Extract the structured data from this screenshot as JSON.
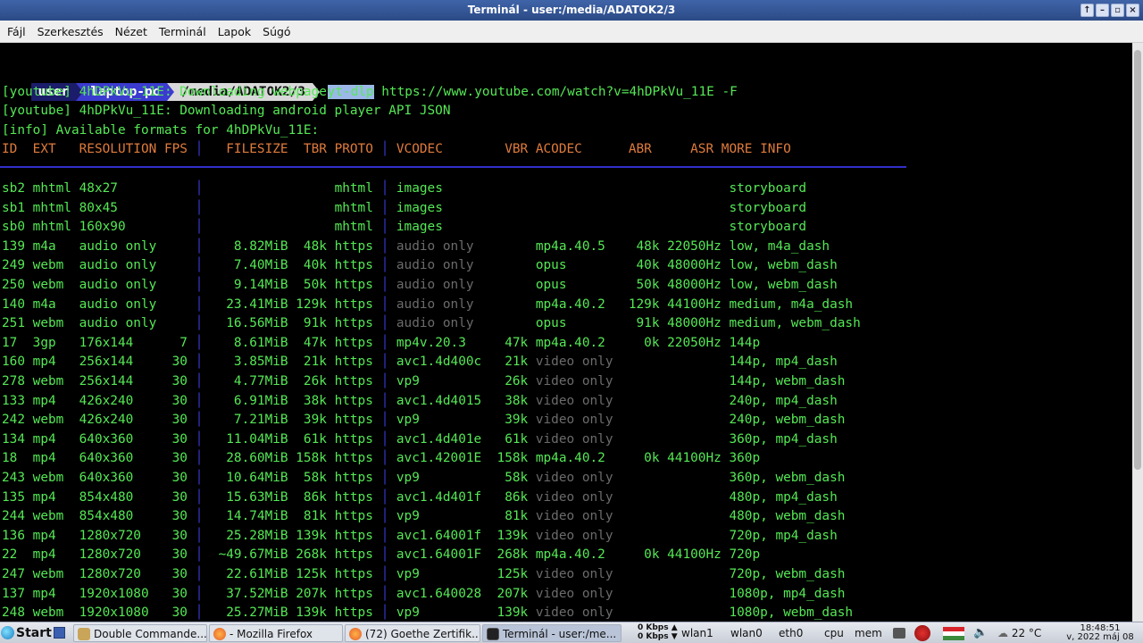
{
  "window": {
    "title": "Terminál - user:/media/ADATOK2/3",
    "buttons": [
      "↑",
      "–",
      "▫",
      "×"
    ]
  },
  "menu": [
    "Fájl",
    "Szerkesztés",
    "Nézet",
    "Terminál",
    "Lapok",
    "Súgó"
  ],
  "prompt": {
    "user": "user",
    "host": "laptop-pc",
    "path": "/media/ADATOK2/3",
    "command_selected": "yt-dlp",
    "command_rest": " https://www.youtube.com/watch?v=4hDPkVu_11E -F"
  },
  "log_lines": [
    "[youtube] 4hDPkVu_11E: Downloading webpage",
    "[youtube] 4hDPkVu_11E: Downloading android player API JSON",
    "[info] Available formats for 4hDPkVu_11E:"
  ],
  "table": {
    "header": "ID  EXT   RESOLUTION FPS │   FILESIZE  TBR PROTO │ VCODEC        VBR ACODEC      ABR     ASR MORE INFO",
    "rows": [
      [
        "sb2",
        "mhtml",
        "48x27",
        "",
        "",
        "",
        "mhtml",
        "images",
        "",
        "",
        "",
        "",
        "storyboard"
      ],
      [
        "sb1",
        "mhtml",
        "80x45",
        "",
        "",
        "",
        "mhtml",
        "images",
        "",
        "",
        "",
        "",
        "storyboard"
      ],
      [
        "sb0",
        "mhtml",
        "160x90",
        "",
        "",
        "",
        "mhtml",
        "images",
        "",
        "",
        "",
        "",
        "storyboard"
      ],
      [
        "139",
        "m4a",
        "audio only",
        "",
        "8.82MiB",
        "48k",
        "https",
        "audio only",
        "",
        "mp4a.40.5",
        "48k",
        "22050Hz",
        "low, m4a_dash"
      ],
      [
        "249",
        "webm",
        "audio only",
        "",
        "7.40MiB",
        "40k",
        "https",
        "audio only",
        "",
        "opus",
        "40k",
        "48000Hz",
        "low, webm_dash"
      ],
      [
        "250",
        "webm",
        "audio only",
        "",
        "9.14MiB",
        "50k",
        "https",
        "audio only",
        "",
        "opus",
        "50k",
        "48000Hz",
        "low, webm_dash"
      ],
      [
        "140",
        "m4a",
        "audio only",
        "",
        "23.41MiB",
        "129k",
        "https",
        "audio only",
        "",
        "mp4a.40.2",
        "129k",
        "44100Hz",
        "medium, m4a_dash"
      ],
      [
        "251",
        "webm",
        "audio only",
        "",
        "16.56MiB",
        "91k",
        "https",
        "audio only",
        "",
        "opus",
        "91k",
        "48000Hz",
        "medium, webm_dash"
      ],
      [
        "17",
        "3gp",
        "176x144",
        "7",
        "8.61MiB",
        "47k",
        "https",
        "mp4v.20.3",
        "47k",
        "mp4a.40.2",
        "0k",
        "22050Hz",
        "144p"
      ],
      [
        "160",
        "mp4",
        "256x144",
        "30",
        "3.85MiB",
        "21k",
        "https",
        "avc1.4d400c",
        "21k",
        "video only",
        "",
        "",
        "144p, mp4_dash"
      ],
      [
        "278",
        "webm",
        "256x144",
        "30",
        "4.77MiB",
        "26k",
        "https",
        "vp9",
        "26k",
        "video only",
        "",
        "",
        "144p, webm_dash"
      ],
      [
        "133",
        "mp4",
        "426x240",
        "30",
        "6.91MiB",
        "38k",
        "https",
        "avc1.4d4015",
        "38k",
        "video only",
        "",
        "",
        "240p, mp4_dash"
      ],
      [
        "242",
        "webm",
        "426x240",
        "30",
        "7.21MiB",
        "39k",
        "https",
        "vp9",
        "39k",
        "video only",
        "",
        "",
        "240p, webm_dash"
      ],
      [
        "134",
        "mp4",
        "640x360",
        "30",
        "11.04MiB",
        "61k",
        "https",
        "avc1.4d401e",
        "61k",
        "video only",
        "",
        "",
        "360p, mp4_dash"
      ],
      [
        "18",
        "mp4",
        "640x360",
        "30",
        "28.60MiB",
        "158k",
        "https",
        "avc1.42001E",
        "158k",
        "mp4a.40.2",
        "0k",
        "44100Hz",
        "360p"
      ],
      [
        "243",
        "webm",
        "640x360",
        "30",
        "10.64MiB",
        "58k",
        "https",
        "vp9",
        "58k",
        "video only",
        "",
        "",
        "360p, webm_dash"
      ],
      [
        "135",
        "mp4",
        "854x480",
        "30",
        "15.63MiB",
        "86k",
        "https",
        "avc1.4d401f",
        "86k",
        "video only",
        "",
        "",
        "480p, mp4_dash"
      ],
      [
        "244",
        "webm",
        "854x480",
        "30",
        "14.74MiB",
        "81k",
        "https",
        "vp9",
        "81k",
        "video only",
        "",
        "",
        "480p, webm_dash"
      ],
      [
        "136",
        "mp4",
        "1280x720",
        "30",
        "25.28MiB",
        "139k",
        "https",
        "avc1.64001f",
        "139k",
        "video only",
        "",
        "",
        "720p, mp4_dash"
      ],
      [
        "22",
        "mp4",
        "1280x720",
        "30",
        "~49.67MiB",
        "268k",
        "https",
        "avc1.64001F",
        "268k",
        "mp4a.40.2",
        "0k",
        "44100Hz",
        "720p"
      ],
      [
        "247",
        "webm",
        "1280x720",
        "30",
        "22.61MiB",
        "125k",
        "https",
        "vp9",
        "125k",
        "video only",
        "",
        "",
        "720p, webm_dash"
      ],
      [
        "137",
        "mp4",
        "1920x1080",
        "30",
        "37.52MiB",
        "207k",
        "https",
        "avc1.640028",
        "207k",
        "video only",
        "",
        "",
        "1080p, mp4_dash"
      ],
      [
        "248",
        "webm",
        "1920x1080",
        "30",
        "25.27MiB",
        "139k",
        "https",
        "vp9",
        "139k",
        "video only",
        "",
        "",
        "1080p, webm_dash"
      ]
    ]
  },
  "taskbar": {
    "start": "Start",
    "tasks": [
      {
        "label": "Double Commande..."
      },
      {
        "label": " - Mozilla Firefox"
      },
      {
        "label": "(72) Goethe Zertifik..."
      },
      {
        "label": "Terminál - user:/me..."
      }
    ],
    "net_down": "0 Kbps ▲",
    "net_up": "0 Kbps ▼",
    "wlan1": "wlan1",
    "wlan0": "wlan0",
    "eth0": "eth0",
    "cpu": "cpu",
    "mem": "mem",
    "temp": "22 °C",
    "time": "18:48:51",
    "date": "v, 2022 máj 08"
  },
  "colors": {
    "green": "#55e855",
    "header": "#e07b3c",
    "grey": "#6b6b6b",
    "separator": "#3a3ad8"
  }
}
